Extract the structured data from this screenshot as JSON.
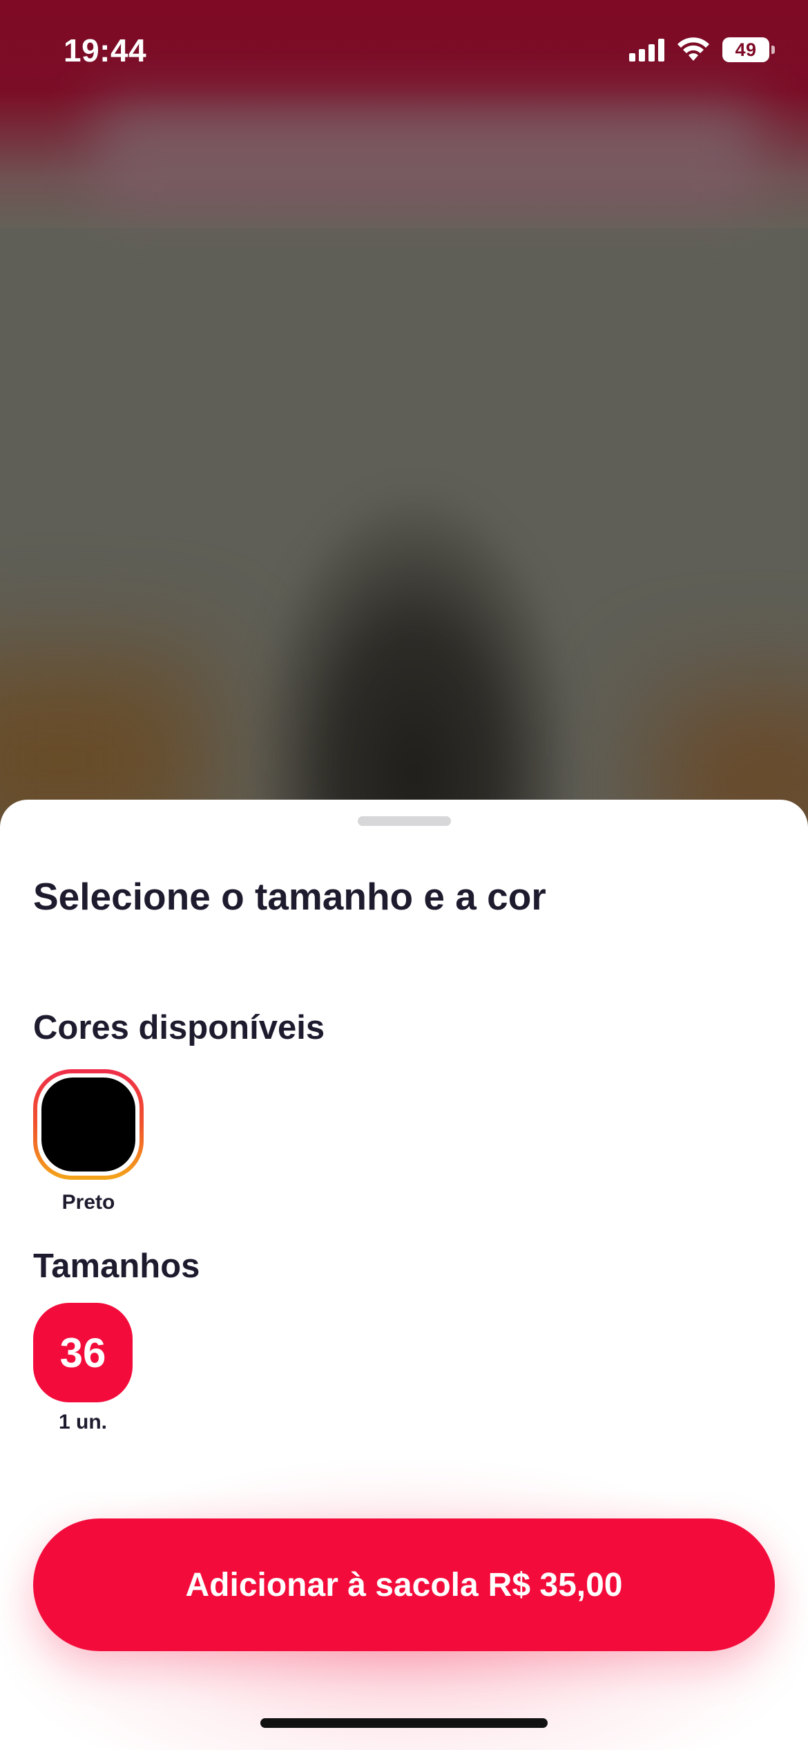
{
  "status_bar": {
    "time": "19:44",
    "battery": "49",
    "icons": [
      "cellular-signal-icon",
      "wifi-icon",
      "battery-icon"
    ]
  },
  "sheet": {
    "title": "Selecione o tamanho e a cor",
    "colors_label": "Cores disponíveis",
    "colors": [
      {
        "name": "Preto",
        "hex": "#000000",
        "selected": true
      }
    ],
    "sizes_label": "Tamanhos",
    "sizes": [
      {
        "value": "36",
        "stock": "1 un.",
        "selected": true
      }
    ],
    "add_button_label": "Adicionar à sacola",
    "add_button_price": "R$ 35,00"
  },
  "theme": {
    "accent": "#f30c3b",
    "text": "#1f1b2e",
    "selection_ring": [
      "#ef2d4a",
      "#f4a518"
    ]
  }
}
